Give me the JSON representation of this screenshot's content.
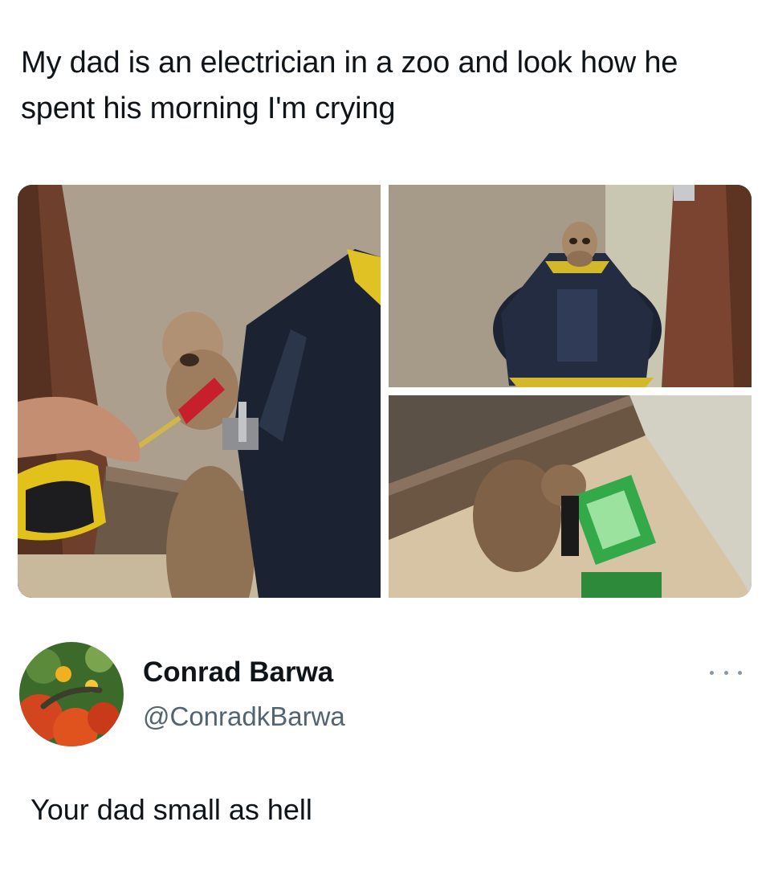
{
  "post": {
    "text": "My dad is an electrician in a zoo and look how he spent his morning I'm crying"
  },
  "media": {
    "photos": [
      {
        "description_icon": "meerkat-holding-screwdriver-photo"
      },
      {
        "description_icon": "meerkat-in-tool-bag-photo"
      },
      {
        "description_icon": "meerkat-with-work-light-photo"
      }
    ]
  },
  "reply": {
    "display_name": "Conrad Barwa",
    "handle": "@ConradkBarwa",
    "text": "Your dad small as hell",
    "more_icon": "more-horizontal-icon"
  },
  "colors": {
    "text": "#0f1419",
    "secondary": "#536471"
  }
}
